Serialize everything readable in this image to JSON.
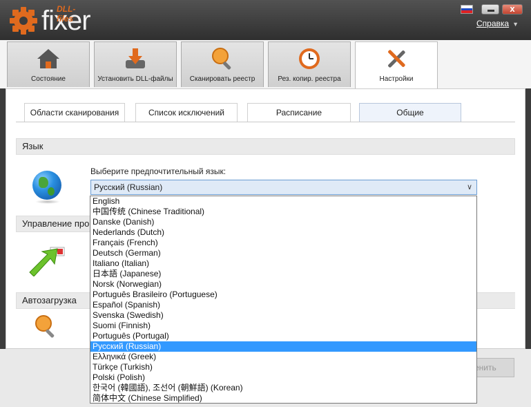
{
  "app": {
    "logo_small": "DLL-files",
    "logo_main": "fixer",
    "help": "Справка"
  },
  "main_tabs": [
    {
      "label": "Состояние",
      "icon": "home-icon"
    },
    {
      "label": "Установить DLL-файлы",
      "icon": "download-icon"
    },
    {
      "label": "Сканировать реестр",
      "icon": "magnifier-icon"
    },
    {
      "label": "Рез. копир. реестра",
      "icon": "clock-backup-icon"
    },
    {
      "label": "Настройки",
      "icon": "tools-icon"
    }
  ],
  "sub_tabs": [
    {
      "label": "Области сканирования"
    },
    {
      "label": "Список исключений"
    },
    {
      "label": "Расписание"
    },
    {
      "label": "Общие"
    }
  ],
  "sections": {
    "language": "Язык",
    "management": "Управление про",
    "autostart": "Автозагрузка"
  },
  "language": {
    "prompt": "Выберите предпочтительный язык:",
    "selected": "Русский (Russian)",
    "options": [
      "English",
      "中国传统 (Chinese Traditional)",
      "Danske (Danish)",
      "Nederlands (Dutch)",
      "Français (French)",
      "Deutsch (German)",
      "Italiano (Italian)",
      "日本語 (Japanese)",
      "Norsk (Norwegian)",
      "Português Brasileiro (Portuguese)",
      "Español (Spanish)",
      "Svenska (Swedish)",
      "Suomi (Finnish)",
      "Português (Portugal)",
      "Русский (Russian)",
      "Ελληνικά (Greek)",
      "Türkçe (Turkish)",
      "Polski (Polish)",
      "한국어 (韓國語), 조선어 (朝鮮語) (Korean)",
      "简体中文 (Chinese Simplified)"
    ],
    "selected_index": 14
  },
  "bottom": {
    "apply_partial": "енить"
  },
  "colors": {
    "accent": "#3399ff",
    "logo_orange": "#e06a1e",
    "titlebar": "#3c3c3c"
  }
}
